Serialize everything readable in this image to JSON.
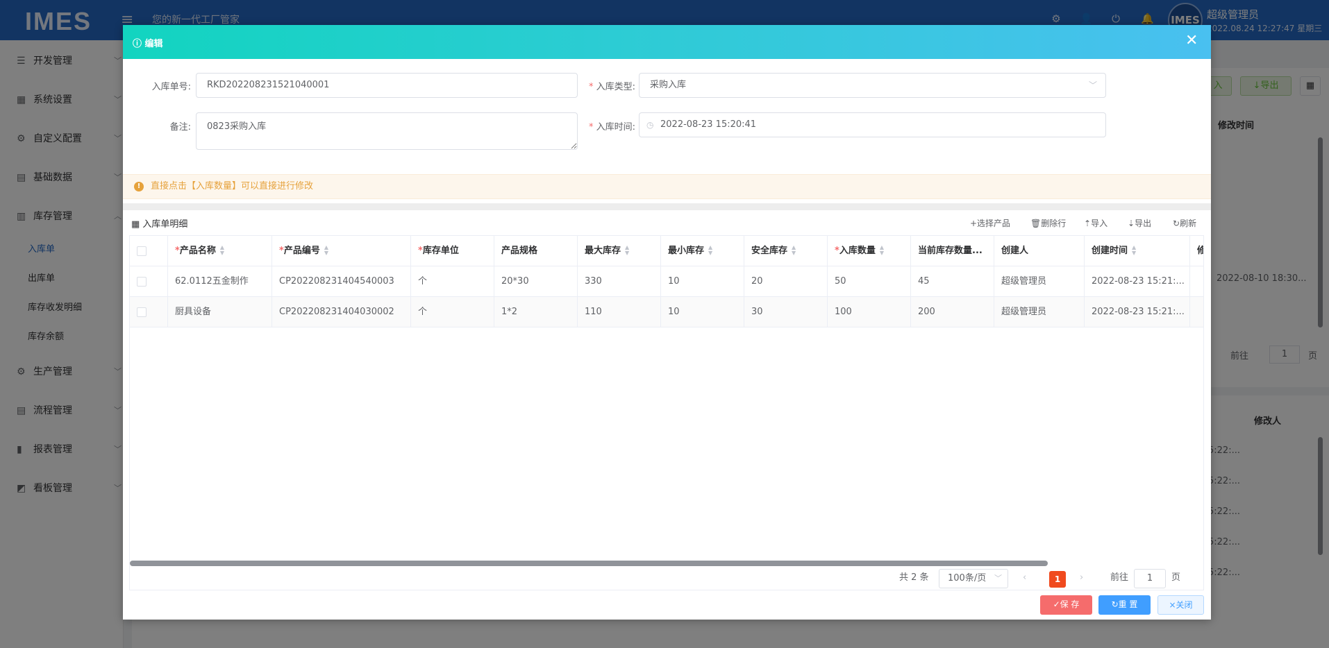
{
  "app": {
    "logo": "IMES",
    "slogan": "您的新一代工厂管家",
    "avatar_text": "IMES",
    "user_name": "超级管理员",
    "datetime": "2022.08.24 12:27:47 星期三"
  },
  "sidebar": {
    "items": [
      {
        "label": "开发管理",
        "icon": "code-icon"
      },
      {
        "label": "系统设置",
        "icon": "grid-icon"
      },
      {
        "label": "自定义配置",
        "icon": "gear-icon"
      },
      {
        "label": "基础数据",
        "icon": "document-icon"
      },
      {
        "label": "库存管理",
        "icon": "inventory-icon"
      }
    ],
    "sub_items": [
      "入库单",
      "出库单",
      "库存收发明细",
      "库存余额"
    ],
    "items_after": [
      {
        "label": "生产管理",
        "icon": "gear-icon"
      },
      {
        "label": "流程管理",
        "icon": "flow-icon"
      },
      {
        "label": "报表管理",
        "icon": "bar-chart-icon"
      },
      {
        "label": "看板管理",
        "icon": "dashboard-icon"
      }
    ]
  },
  "background": {
    "import_label": "入",
    "export_label": "↓导出",
    "col_modify_time": "修改时间",
    "cell_modify_time": "2022-08-10 18:30...",
    "goto_label": "前往",
    "goto_value": "1",
    "page_label": "页",
    "col_modifier": "修改人",
    "partial_time": "5:22:..."
  },
  "modal": {
    "title": "编辑",
    "form": {
      "order_no_label": "入库单号:",
      "order_no_value": "RKD202208231521040001",
      "type_label": "入库类型:",
      "type_value": "采购入库",
      "remark_label": "备注:",
      "remark_value": "0823采购入库",
      "time_label": "入库时间:",
      "time_value": "2022-08-23 15:20:41"
    },
    "alert": "直接点击【入库数量】可以直接进行修改",
    "detail_title": "入库单明细",
    "toolbar": {
      "select": "+选择产品",
      "delete": "删除行",
      "import": "导入",
      "export": "导出",
      "refresh": "刷新"
    },
    "table": {
      "headers": [
        "产品名称",
        "产品编号",
        "库存单位",
        "产品规格",
        "最大库存",
        "最小库存",
        "安全库存",
        "入库数量",
        "当前库存数量...",
        "创建人",
        "创建时间",
        "修"
      ],
      "rows": [
        [
          "62.0112五金制作",
          "CP202208231404540003",
          "个",
          "20*30",
          "330",
          "10",
          "20",
          "50",
          "45",
          "超级管理员",
          "2022-08-23 15:21:...",
          ""
        ],
        [
          "厨具设备",
          "CP202208231404030002",
          "个",
          "1*2",
          "110",
          "10",
          "30",
          "100",
          "200",
          "超级管理员",
          "2022-08-23 15:21:...",
          ""
        ]
      ]
    },
    "pager": {
      "total": "共 2 条",
      "page_size": "100条/页",
      "current": "1",
      "goto_label": "前往",
      "goto_value": "1",
      "page_label": "页"
    },
    "footer": {
      "save": "✓保 存",
      "reset": "↻重 置",
      "close": "×关闭"
    }
  },
  "colors": {
    "header_blue": "#2469c5",
    "modal_gradient_start": "#12d4c0",
    "modal_gradient_end": "#49c0f0",
    "save_red": "#f56c6c",
    "reset_blue": "#409eff",
    "page_active": "#f04a1e",
    "warning": "#e6a23c"
  }
}
